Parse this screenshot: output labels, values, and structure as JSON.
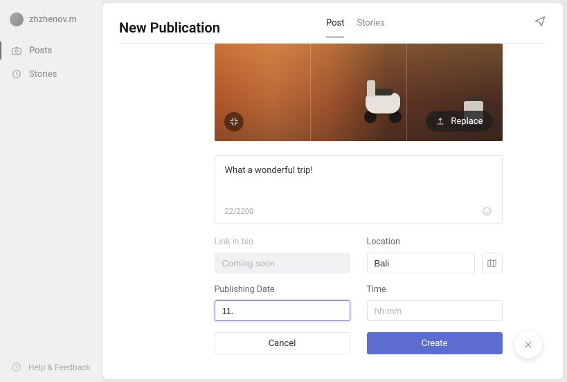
{
  "sidebar": {
    "username": "zhzhenov.m",
    "nav": {
      "posts": "Posts",
      "stories": "Stories"
    },
    "help": "Help & Feedback"
  },
  "header": {
    "title": "New Publication",
    "tabs": {
      "post": "Post",
      "stories": "Stories"
    }
  },
  "image": {
    "replace_label": "Replace"
  },
  "caption": {
    "text": "What a wonderful trip!",
    "counter": "22/2200"
  },
  "fields": {
    "link_in_bio": {
      "label": "Link in bio",
      "placeholder": "Coming soon"
    },
    "location": {
      "label": "Location",
      "value": "Bali"
    },
    "publishing_date": {
      "label": "Publishing Date",
      "value": "11."
    },
    "time": {
      "label": "Time",
      "placeholder": "hh:mm"
    }
  },
  "buttons": {
    "cancel": "Cancel",
    "create": "Create"
  }
}
